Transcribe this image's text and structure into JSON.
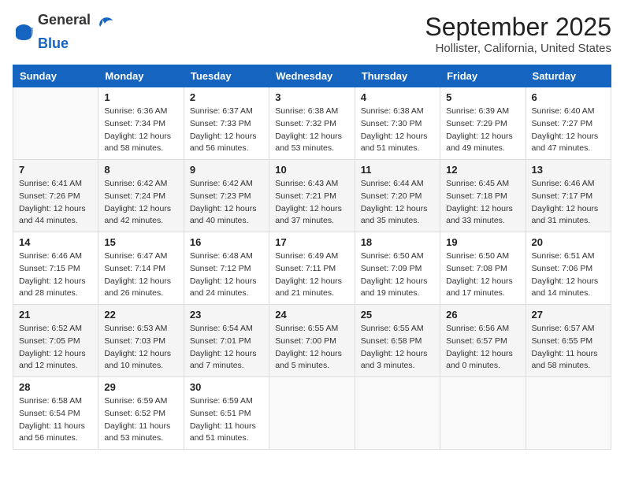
{
  "header": {
    "logo_general": "General",
    "logo_blue": "Blue",
    "month_title": "September 2025",
    "location": "Hollister, California, United States"
  },
  "weekdays": [
    "Sunday",
    "Monday",
    "Tuesday",
    "Wednesday",
    "Thursday",
    "Friday",
    "Saturday"
  ],
  "weeks": [
    [
      {
        "day": "",
        "info": ""
      },
      {
        "day": "1",
        "info": "Sunrise: 6:36 AM\nSunset: 7:34 PM\nDaylight: 12 hours\nand 58 minutes."
      },
      {
        "day": "2",
        "info": "Sunrise: 6:37 AM\nSunset: 7:33 PM\nDaylight: 12 hours\nand 56 minutes."
      },
      {
        "day": "3",
        "info": "Sunrise: 6:38 AM\nSunset: 7:32 PM\nDaylight: 12 hours\nand 53 minutes."
      },
      {
        "day": "4",
        "info": "Sunrise: 6:38 AM\nSunset: 7:30 PM\nDaylight: 12 hours\nand 51 minutes."
      },
      {
        "day": "5",
        "info": "Sunrise: 6:39 AM\nSunset: 7:29 PM\nDaylight: 12 hours\nand 49 minutes."
      },
      {
        "day": "6",
        "info": "Sunrise: 6:40 AM\nSunset: 7:27 PM\nDaylight: 12 hours\nand 47 minutes."
      }
    ],
    [
      {
        "day": "7",
        "info": "Sunrise: 6:41 AM\nSunset: 7:26 PM\nDaylight: 12 hours\nand 44 minutes."
      },
      {
        "day": "8",
        "info": "Sunrise: 6:42 AM\nSunset: 7:24 PM\nDaylight: 12 hours\nand 42 minutes."
      },
      {
        "day": "9",
        "info": "Sunrise: 6:42 AM\nSunset: 7:23 PM\nDaylight: 12 hours\nand 40 minutes."
      },
      {
        "day": "10",
        "info": "Sunrise: 6:43 AM\nSunset: 7:21 PM\nDaylight: 12 hours\nand 37 minutes."
      },
      {
        "day": "11",
        "info": "Sunrise: 6:44 AM\nSunset: 7:20 PM\nDaylight: 12 hours\nand 35 minutes."
      },
      {
        "day": "12",
        "info": "Sunrise: 6:45 AM\nSunset: 7:18 PM\nDaylight: 12 hours\nand 33 minutes."
      },
      {
        "day": "13",
        "info": "Sunrise: 6:46 AM\nSunset: 7:17 PM\nDaylight: 12 hours\nand 31 minutes."
      }
    ],
    [
      {
        "day": "14",
        "info": "Sunrise: 6:46 AM\nSunset: 7:15 PM\nDaylight: 12 hours\nand 28 minutes."
      },
      {
        "day": "15",
        "info": "Sunrise: 6:47 AM\nSunset: 7:14 PM\nDaylight: 12 hours\nand 26 minutes."
      },
      {
        "day": "16",
        "info": "Sunrise: 6:48 AM\nSunset: 7:12 PM\nDaylight: 12 hours\nand 24 minutes."
      },
      {
        "day": "17",
        "info": "Sunrise: 6:49 AM\nSunset: 7:11 PM\nDaylight: 12 hours\nand 21 minutes."
      },
      {
        "day": "18",
        "info": "Sunrise: 6:50 AM\nSunset: 7:09 PM\nDaylight: 12 hours\nand 19 minutes."
      },
      {
        "day": "19",
        "info": "Sunrise: 6:50 AM\nSunset: 7:08 PM\nDaylight: 12 hours\nand 17 minutes."
      },
      {
        "day": "20",
        "info": "Sunrise: 6:51 AM\nSunset: 7:06 PM\nDaylight: 12 hours\nand 14 minutes."
      }
    ],
    [
      {
        "day": "21",
        "info": "Sunrise: 6:52 AM\nSunset: 7:05 PM\nDaylight: 12 hours\nand 12 minutes."
      },
      {
        "day": "22",
        "info": "Sunrise: 6:53 AM\nSunset: 7:03 PM\nDaylight: 12 hours\nand 10 minutes."
      },
      {
        "day": "23",
        "info": "Sunrise: 6:54 AM\nSunset: 7:01 PM\nDaylight: 12 hours\nand 7 minutes."
      },
      {
        "day": "24",
        "info": "Sunrise: 6:55 AM\nSunset: 7:00 PM\nDaylight: 12 hours\nand 5 minutes."
      },
      {
        "day": "25",
        "info": "Sunrise: 6:55 AM\nSunset: 6:58 PM\nDaylight: 12 hours\nand 3 minutes."
      },
      {
        "day": "26",
        "info": "Sunrise: 6:56 AM\nSunset: 6:57 PM\nDaylight: 12 hours\nand 0 minutes."
      },
      {
        "day": "27",
        "info": "Sunrise: 6:57 AM\nSunset: 6:55 PM\nDaylight: 11 hours\nand 58 minutes."
      }
    ],
    [
      {
        "day": "28",
        "info": "Sunrise: 6:58 AM\nSunset: 6:54 PM\nDaylight: 11 hours\nand 56 minutes."
      },
      {
        "day": "29",
        "info": "Sunrise: 6:59 AM\nSunset: 6:52 PM\nDaylight: 11 hours\nand 53 minutes."
      },
      {
        "day": "30",
        "info": "Sunrise: 6:59 AM\nSunset: 6:51 PM\nDaylight: 11 hours\nand 51 minutes."
      },
      {
        "day": "",
        "info": ""
      },
      {
        "day": "",
        "info": ""
      },
      {
        "day": "",
        "info": ""
      },
      {
        "day": "",
        "info": ""
      }
    ]
  ]
}
